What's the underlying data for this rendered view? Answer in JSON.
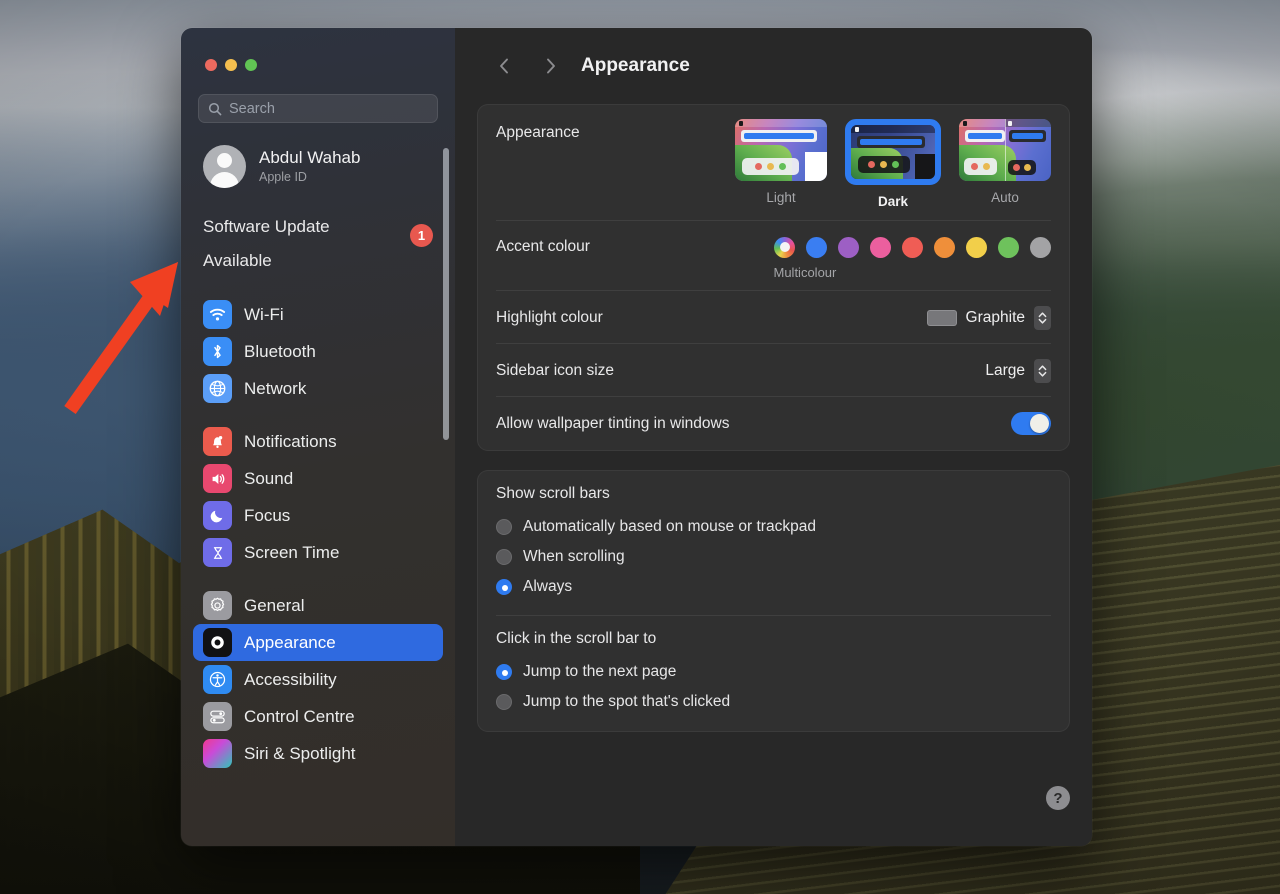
{
  "window": {
    "traffic_lights": [
      "close",
      "minimize",
      "zoom"
    ],
    "title": "Appearance"
  },
  "sidebar": {
    "search": {
      "placeholder": "Search",
      "value": ""
    },
    "account": {
      "name": "Abdul Wahab",
      "subtitle": "Apple ID"
    },
    "update": {
      "label": "Software Update Available",
      "badge": "1"
    },
    "groups": [
      {
        "items": [
          {
            "label": "Wi-Fi",
            "icon": "wifi-icon",
            "selected": false
          },
          {
            "label": "Bluetooth",
            "icon": "bluetooth-icon",
            "selected": false
          },
          {
            "label": "Network",
            "icon": "globe-icon",
            "selected": false
          }
        ]
      },
      {
        "items": [
          {
            "label": "Notifications",
            "icon": "bell-icon",
            "selected": false
          },
          {
            "label": "Sound",
            "icon": "speaker-icon",
            "selected": false
          },
          {
            "label": "Focus",
            "icon": "moon-icon",
            "selected": false
          },
          {
            "label": "Screen Time",
            "icon": "hourglass-icon",
            "selected": false
          }
        ]
      },
      {
        "items": [
          {
            "label": "General",
            "icon": "gear-icon",
            "selected": false
          },
          {
            "label": "Appearance",
            "icon": "appearance-icon",
            "selected": true
          },
          {
            "label": "Accessibility",
            "icon": "accessibility-icon",
            "selected": false
          },
          {
            "label": "Control Centre",
            "icon": "sliders-icon",
            "selected": false
          },
          {
            "label": "Siri & Spotlight",
            "icon": "siri-icon",
            "selected": false
          }
        ]
      }
    ]
  },
  "content": {
    "appearance": {
      "label": "Appearance",
      "options": [
        {
          "label": "Light",
          "selected": false
        },
        {
          "label": "Dark",
          "selected": true
        },
        {
          "label": "Auto",
          "selected": false
        }
      ]
    },
    "accent": {
      "label": "Accent colour",
      "caption": "Multicolour",
      "swatches": [
        {
          "name": "Multicolour",
          "color": "multicolour",
          "selected": true
        },
        {
          "name": "Blue",
          "color": "#3a7ef2"
        },
        {
          "name": "Purple",
          "color": "#9d5fc4"
        },
        {
          "name": "Pink",
          "color": "#ec5f9e"
        },
        {
          "name": "Red",
          "color": "#ef5d55"
        },
        {
          "name": "Orange",
          "color": "#ef8f3a"
        },
        {
          "name": "Yellow",
          "color": "#f2cf4a"
        },
        {
          "name": "Green",
          "color": "#6ec25c"
        },
        {
          "name": "Graphite",
          "color": "#a3a3a5"
        }
      ]
    },
    "highlight": {
      "label": "Highlight colour",
      "value": "Graphite",
      "swatch": "#77777a"
    },
    "sidebar_icon_size": {
      "label": "Sidebar icon size",
      "value": "Large"
    },
    "wallpaper_tinting": {
      "label": "Allow wallpaper tinting in windows",
      "value": "on"
    },
    "scroll_bars": {
      "title": "Show scroll bars",
      "options": [
        {
          "label": "Automatically based on mouse or trackpad",
          "selected": false
        },
        {
          "label": "When scrolling",
          "selected": false
        },
        {
          "label": "Always",
          "selected": true
        }
      ]
    },
    "scroll_click": {
      "title": "Click in the scroll bar to",
      "options": [
        {
          "label": "Jump to the next page",
          "selected": true
        },
        {
          "label": "Jump to the spot that's clicked",
          "selected": false
        }
      ]
    },
    "help": {
      "label": "?"
    }
  },
  "annotation": {
    "arrow_color": "#f04022"
  }
}
